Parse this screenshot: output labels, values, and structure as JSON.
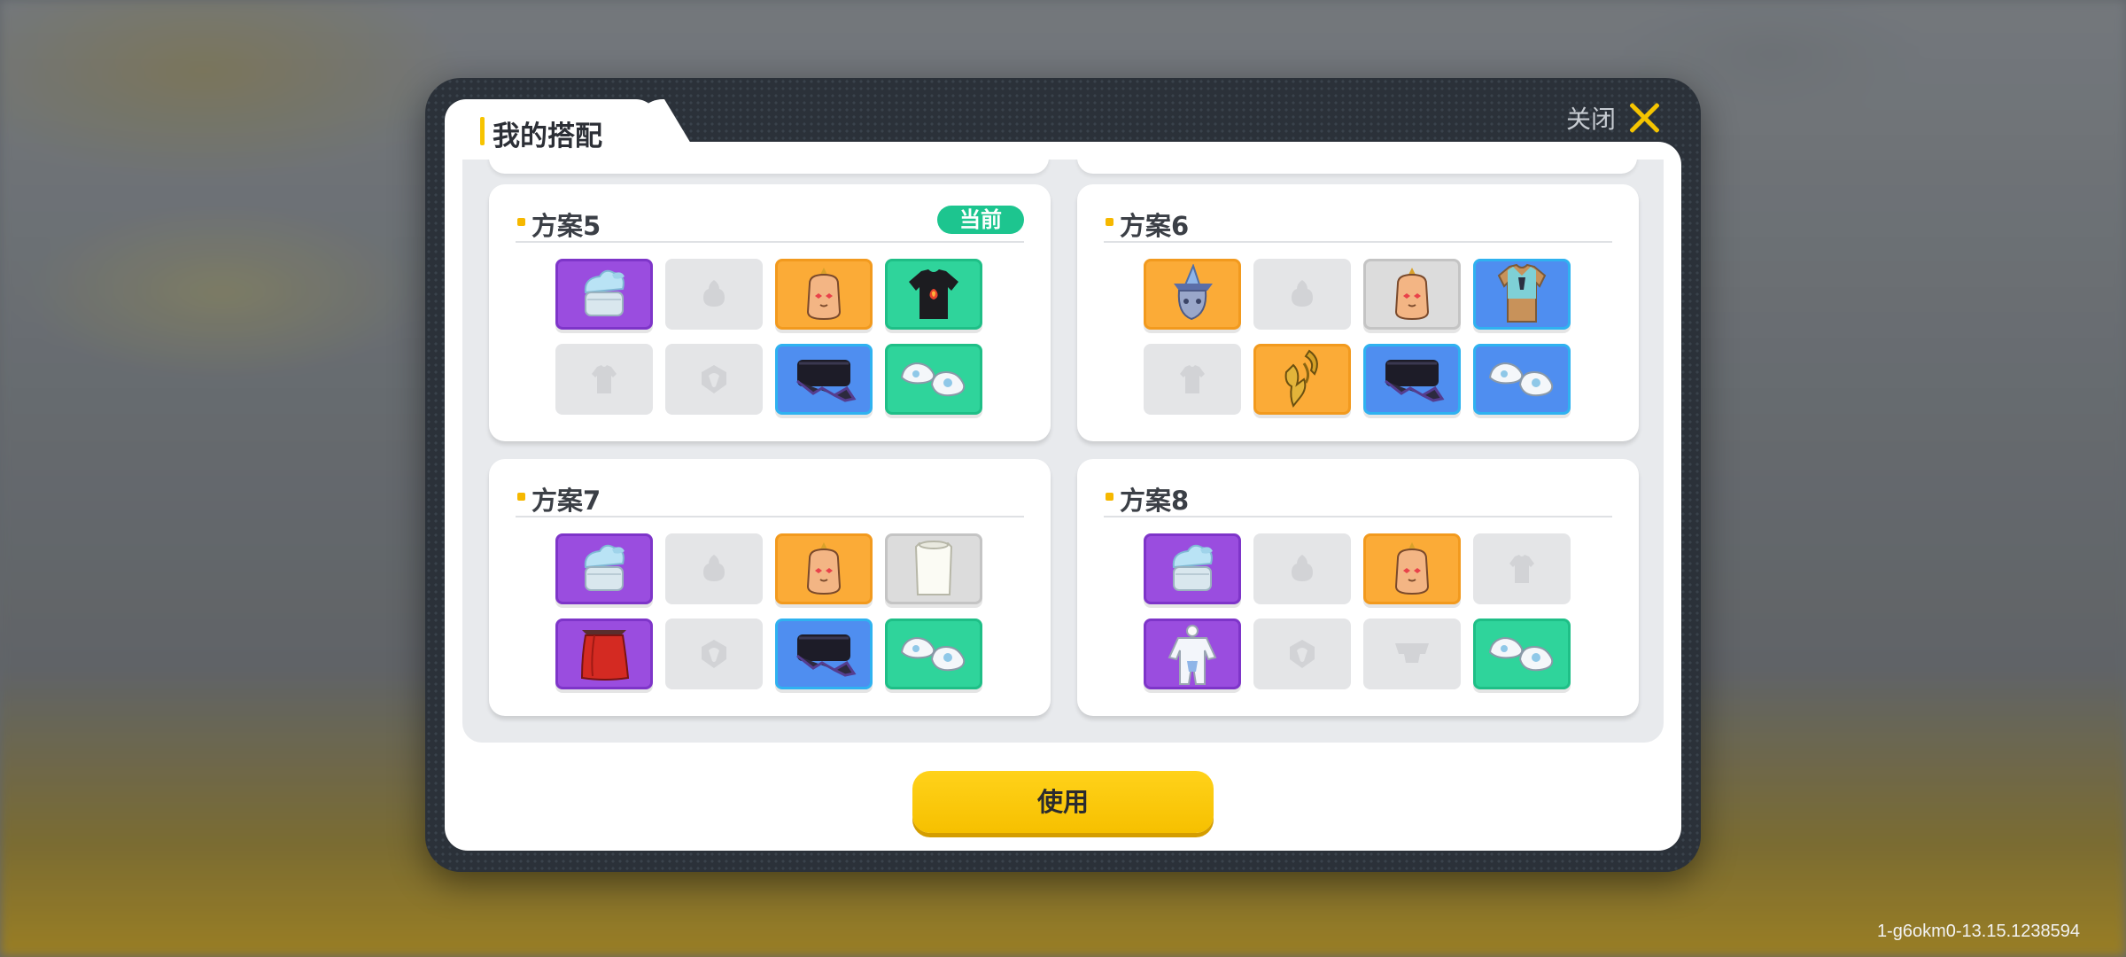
{
  "dialog": {
    "title": "我的搭配",
    "close_label": "关闭",
    "use_label": "使用"
  },
  "outfits": [
    {
      "name": "方案5",
      "badge": "当前",
      "slots": [
        {
          "item": "hat-icon",
          "rarity": "purple"
        },
        {
          "item": "empty-hair-icon",
          "rarity": "empty"
        },
        {
          "item": "face-mask-icon",
          "rarity": "orange"
        },
        {
          "item": "black-shirt-icon",
          "rarity": "green"
        },
        {
          "item": "empty-top-icon",
          "rarity": "empty"
        },
        {
          "item": "empty-accessory-icon",
          "rarity": "empty"
        },
        {
          "item": "pants-icon",
          "rarity": "blue"
        },
        {
          "item": "shoes-icon",
          "rarity": "green"
        }
      ]
    },
    {
      "name": "方案6",
      "badge": "",
      "slots": [
        {
          "item": "wizard-hat-icon",
          "rarity": "orange"
        },
        {
          "item": "empty-hair-icon",
          "rarity": "empty"
        },
        {
          "item": "face-mask-icon",
          "rarity": "gray"
        },
        {
          "item": "blue-shirt-icon",
          "rarity": "blue"
        },
        {
          "item": "empty-top-icon",
          "rarity": "empty"
        },
        {
          "item": "golden-wings-icon",
          "rarity": "orange"
        },
        {
          "item": "pants-icon",
          "rarity": "blue"
        },
        {
          "item": "shoes-icon",
          "rarity": "blue"
        }
      ]
    },
    {
      "name": "方案7",
      "badge": "",
      "slots": [
        {
          "item": "hat-icon",
          "rarity": "purple"
        },
        {
          "item": "empty-hair-icon",
          "rarity": "empty"
        },
        {
          "item": "face-mask-icon",
          "rarity": "orange"
        },
        {
          "item": "white-shirt-icon",
          "rarity": "gray"
        },
        {
          "item": "red-cape-icon",
          "rarity": "purple"
        },
        {
          "item": "empty-accessory-icon",
          "rarity": "empty"
        },
        {
          "item": "pants-icon",
          "rarity": "blue"
        },
        {
          "item": "shoes-icon",
          "rarity": "green"
        }
      ]
    },
    {
      "name": "方案8",
      "badge": "",
      "slots": [
        {
          "item": "hat-icon",
          "rarity": "purple"
        },
        {
          "item": "empty-hair-icon",
          "rarity": "empty"
        },
        {
          "item": "face-mask-icon",
          "rarity": "orange"
        },
        {
          "item": "empty-top-icon",
          "rarity": "empty"
        },
        {
          "item": "suit-icon",
          "rarity": "purple"
        },
        {
          "item": "empty-accessory-icon",
          "rarity": "empty"
        },
        {
          "item": "empty-pants-icon",
          "rarity": "empty"
        },
        {
          "item": "shoes-icon",
          "rarity": "green"
        }
      ]
    }
  ],
  "footer": {
    "version": "1-g6okm0-13.15.1238594"
  },
  "colors": {
    "accent_yellow": "#f6c000",
    "current_badge": "#1dc58f",
    "purple": "#9a4ddf",
    "orange": "#fbab37",
    "green": "#2fd49b",
    "blue": "#4f8ef0"
  }
}
